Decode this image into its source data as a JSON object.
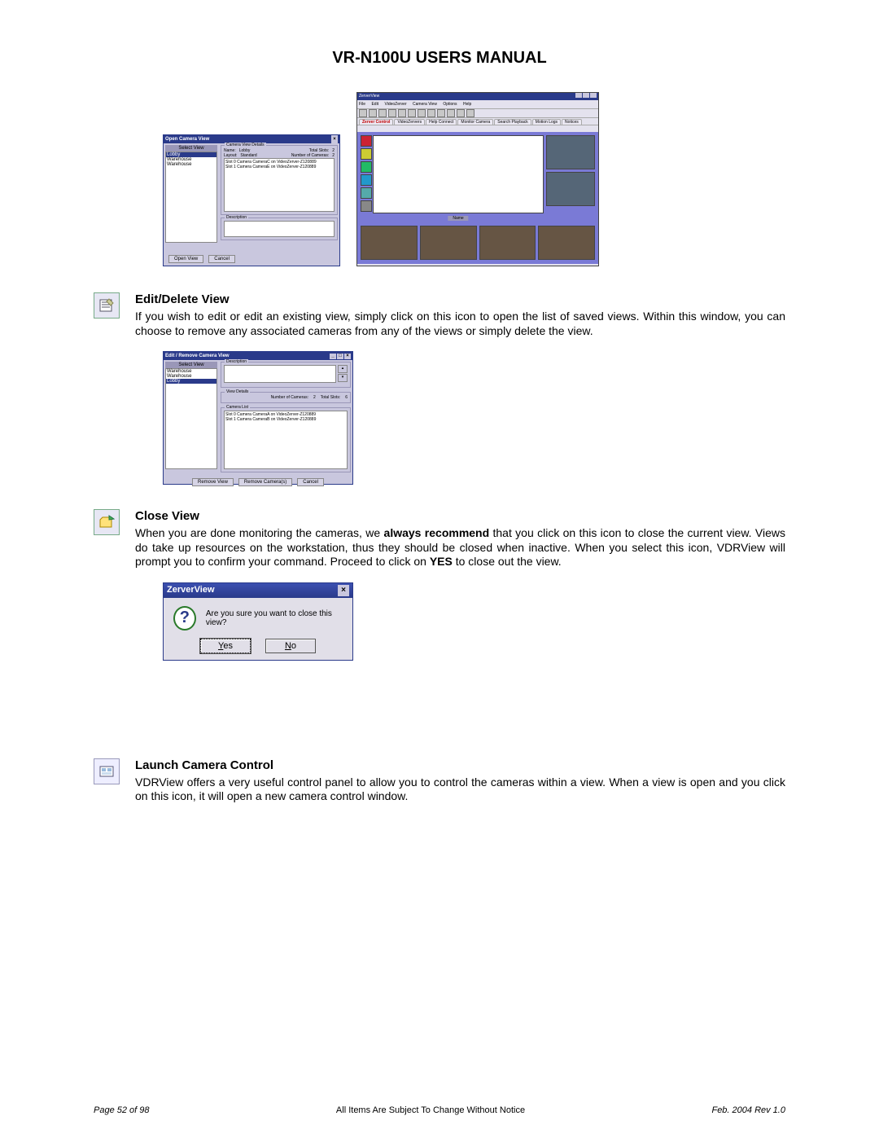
{
  "doc_title": "VR-N100U USERS MANUAL",
  "open_view_dialog": {
    "title": "Open Camera View",
    "select_view_label": "Select View",
    "views": [
      "Lobby",
      "Warehouse",
      "Warehouse"
    ],
    "details_legend": "Camera View Details",
    "name_label": "Name:",
    "name_value": "Lobby",
    "layout_label": "Layout:",
    "layout_value": "Standard",
    "total_slots_label": "Total Slots:",
    "total_slots_value": "2",
    "num_cameras_label": "Number of Cameras:",
    "num_cameras_value": "2",
    "camera_lines": [
      "Slot 0 Camera CameraC on VideoZerver-Z120889",
      "Slot 1 Camera CameraE on VideoZerver-Z120889"
    ],
    "description_legend": "Description",
    "btn_open": "Open View",
    "btn_cancel": "Cancel"
  },
  "zerver_main": {
    "title": "ZerverView",
    "menus": [
      "File",
      "Edit",
      "VideoZerver",
      "Camera View",
      "Options",
      "Help"
    ],
    "tabs": [
      "Zerver Control",
      "VideoZervers",
      "Help Connect",
      "Monitor Camera",
      "Search Playback",
      "Motion Logs",
      "Notices"
    ],
    "caption": "Name"
  },
  "edit_view": {
    "heading": "Edit/Delete View",
    "para": "If you wish to edit or edit an existing view, simply click on this icon to open the list of saved views. Within this window, you can choose to remove any associated cameras from any of the views or simply delete the view."
  },
  "edit_dialog": {
    "title": "Edit / Remove Camera View",
    "select_view_label": "Select View",
    "views": [
      "Warehouse",
      "Warehouse",
      "Lobby"
    ],
    "description_legend": "Description",
    "view_details_legend": "View Details",
    "num_cameras_label": "Number of Cameras:",
    "num_cameras_value": "2",
    "total_slots_label": "Total Slots:",
    "total_slots_value": "6",
    "camera_list_legend": "Camera List",
    "camera_lines": [
      "Slot 0 Camera CameraA on VideoZerver-Z120889",
      "Slot 1 Camera CameraB on VideoZerver-Z120889"
    ],
    "btn_remove_view": "Remove View",
    "btn_remove_cameras": "Remove Camera(s)",
    "btn_cancel": "Cancel"
  },
  "close_view": {
    "heading": "Close View",
    "para_pre": "When you are done monitoring the cameras, we ",
    "para_bold1": "always recommend",
    "para_mid": " that you click on this icon to close the current view. Views do take up resources on the workstation, thus they should be closed when inactive. When you select this icon, VDRView will prompt you to confirm your command. Proceed to click on ",
    "para_bold2": "YES",
    "para_post": " to close out the view."
  },
  "confirm_dialog": {
    "title": "ZerverView",
    "message": "Are you sure you want to close this view?",
    "btn_yes": "Yes",
    "btn_no": "No"
  },
  "launch_cam": {
    "heading": "Launch Camera Control",
    "para": "VDRView offers a very useful control panel to allow you to control the cameras within a view. When a view is open and you click on this icon, it will open a new camera control window."
  },
  "footer": {
    "left": "Page 52 of 98",
    "center": "All Items Are Subject To Change Without Notice",
    "right": "Feb. 2004 Rev 1.0"
  }
}
